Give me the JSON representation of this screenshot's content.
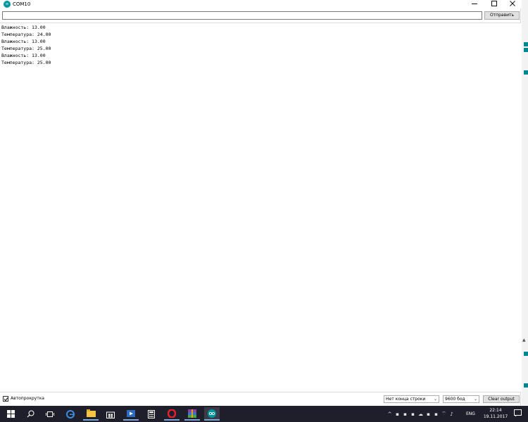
{
  "window": {
    "title": "COM10",
    "app_icon_glyph": "∞"
  },
  "input": {
    "value": "",
    "send_label": "Отправить"
  },
  "output": {
    "lines": [
      "Влажность: 13.00",
      "Температура: 24.00",
      "Влажность: 13.00",
      "Температура: 25.00",
      "Влажность: 13.00",
      "Температура: 25.00"
    ]
  },
  "status": {
    "autoscroll_label": "Автопрокрутка",
    "autoscroll_checked": true,
    "line_ending": "Нет конца строки",
    "baud": "9600 бод",
    "clear_label": "Clear output"
  },
  "taskbar": {
    "lang": "ENG",
    "time": "22:14",
    "date": "19.11.2017"
  },
  "colors": {
    "accent": "#00979c",
    "taskbar": "#1f1f2b"
  }
}
